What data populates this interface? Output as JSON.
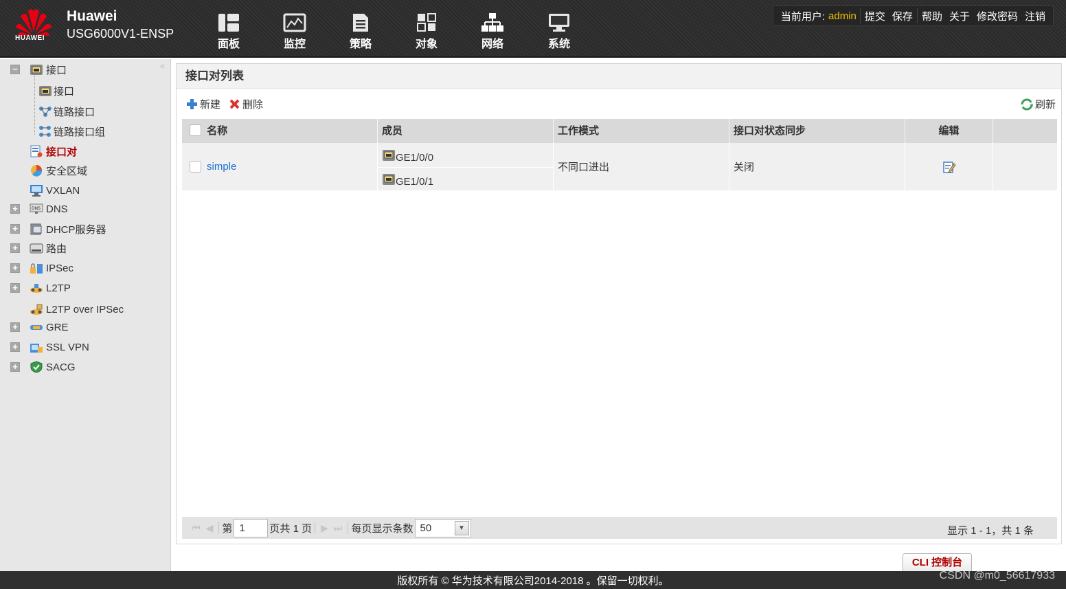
{
  "header": {
    "logo_text": "HUAWEI",
    "brand": "Huawei",
    "product": "USG6000V1-ENSP",
    "nav": [
      {
        "label": "面板",
        "icon": "dashboard-icon"
      },
      {
        "label": "监控",
        "icon": "monitor-icon"
      },
      {
        "label": "策略",
        "icon": "policy-icon"
      },
      {
        "label": "对象",
        "icon": "object-icon"
      },
      {
        "label": "网络",
        "icon": "network-icon"
      },
      {
        "label": "系统",
        "icon": "system-icon"
      }
    ],
    "user": {
      "current_user_label": "当前用户:",
      "username": "admin",
      "links": [
        "提交",
        "保存",
        "帮助",
        "关于",
        "修改密码",
        "注销"
      ]
    }
  },
  "sidebar": {
    "items": [
      {
        "label": "接口",
        "icon": "interface-icon",
        "toggle": "−"
      },
      {
        "label": "接口",
        "icon": "interface-icon"
      },
      {
        "label": "链路接口",
        "icon": "link-interface-icon"
      },
      {
        "label": "链路接口组",
        "icon": "link-interface-group-icon"
      },
      {
        "label": "接口对",
        "icon": "interface-pair-icon"
      },
      {
        "label": "安全区域",
        "icon": "security-zone-icon"
      },
      {
        "label": "VXLAN",
        "icon": "vxlan-icon"
      },
      {
        "label": "DNS",
        "icon": "dns-icon",
        "toggle": "+"
      },
      {
        "label": "DHCP服务器",
        "icon": "dhcp-server-icon",
        "toggle": "+"
      },
      {
        "label": "路由",
        "icon": "route-icon",
        "toggle": "+"
      },
      {
        "label": "IPSec",
        "icon": "ipsec-icon",
        "toggle": "+"
      },
      {
        "label": "L2TP",
        "icon": "l2tp-icon",
        "toggle": "+"
      },
      {
        "label": "L2TP over IPSec",
        "icon": "l2tp-over-ipsec-icon"
      },
      {
        "label": "GRE",
        "icon": "gre-icon",
        "toggle": "+"
      },
      {
        "label": "SSL VPN",
        "icon": "ssl-vpn-icon",
        "toggle": "+"
      },
      {
        "label": "SACG",
        "icon": "sacg-icon",
        "toggle": "+"
      }
    ],
    "active": "接口对",
    "collapse_glyph": "«"
  },
  "main": {
    "title": "接口对列表",
    "toolbar": {
      "new_label": "新建",
      "delete_label": "删除",
      "refresh_label": "刷新"
    },
    "table": {
      "columns": [
        "名称",
        "成员",
        "工作模式",
        "接口对状态同步",
        "编辑"
      ],
      "rows": [
        {
          "name": "simple",
          "members": [
            "GE1/0/0",
            "GE1/0/1"
          ],
          "mode": "不同口进出",
          "sync": "关闭"
        }
      ]
    },
    "pager": {
      "first": "⏮",
      "prev": "◀",
      "next": "▶",
      "last": "⏭",
      "page_prefix": "第",
      "page_value": "1",
      "page_suffix": "页共 1 页",
      "per_page_label": "每页显示条数",
      "per_page_value": "50",
      "summary": "显示 1 - 1，共 1 条"
    }
  },
  "footer": {
    "cli_button": "CLI 控制台",
    "copyright": "版权所有 © 华为技术有限公司2014-2018 。保留一切权利。",
    "watermark": "CSDN @m0_56617933"
  }
}
